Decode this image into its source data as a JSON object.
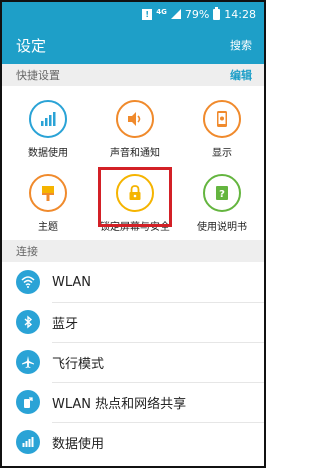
{
  "status_bar": {
    "notification": "!",
    "network": "4G",
    "battery": "79%",
    "time": "14:28"
  },
  "app_bar": {
    "title": "设定",
    "search_label": "搜索"
  },
  "quick_settings": {
    "header": "快捷设置",
    "edit_label": "编辑",
    "items": [
      {
        "label": "数据使用",
        "icon": "data-usage-icon",
        "color": "#2aa3d6"
      },
      {
        "label": "声音和通知",
        "icon": "sound-icon",
        "color": "#f08a2c"
      },
      {
        "label": "显示",
        "icon": "display-icon",
        "color": "#f08a2c"
      },
      {
        "label": "主题",
        "icon": "theme-icon",
        "color": "#f08a2c"
      },
      {
        "label": "锁定屏幕与安全",
        "icon": "lock-icon",
        "color": "#f5b400"
      },
      {
        "label": "使用说明书",
        "icon": "manual-icon",
        "color": "#64b53f"
      }
    ]
  },
  "connections": {
    "header": "连接",
    "items": [
      {
        "label": "WLAN",
        "icon": "wifi-icon"
      },
      {
        "label": "蓝牙",
        "icon": "bluetooth-icon"
      },
      {
        "label": "飞行模式",
        "icon": "airplane-icon"
      },
      {
        "label": "WLAN 热点和网络共享",
        "icon": "hotspot-icon"
      },
      {
        "label": "数据使用",
        "icon": "data-usage-icon"
      }
    ]
  },
  "colors": {
    "accent": "#1e9fc8",
    "highlight": "#d32026"
  }
}
